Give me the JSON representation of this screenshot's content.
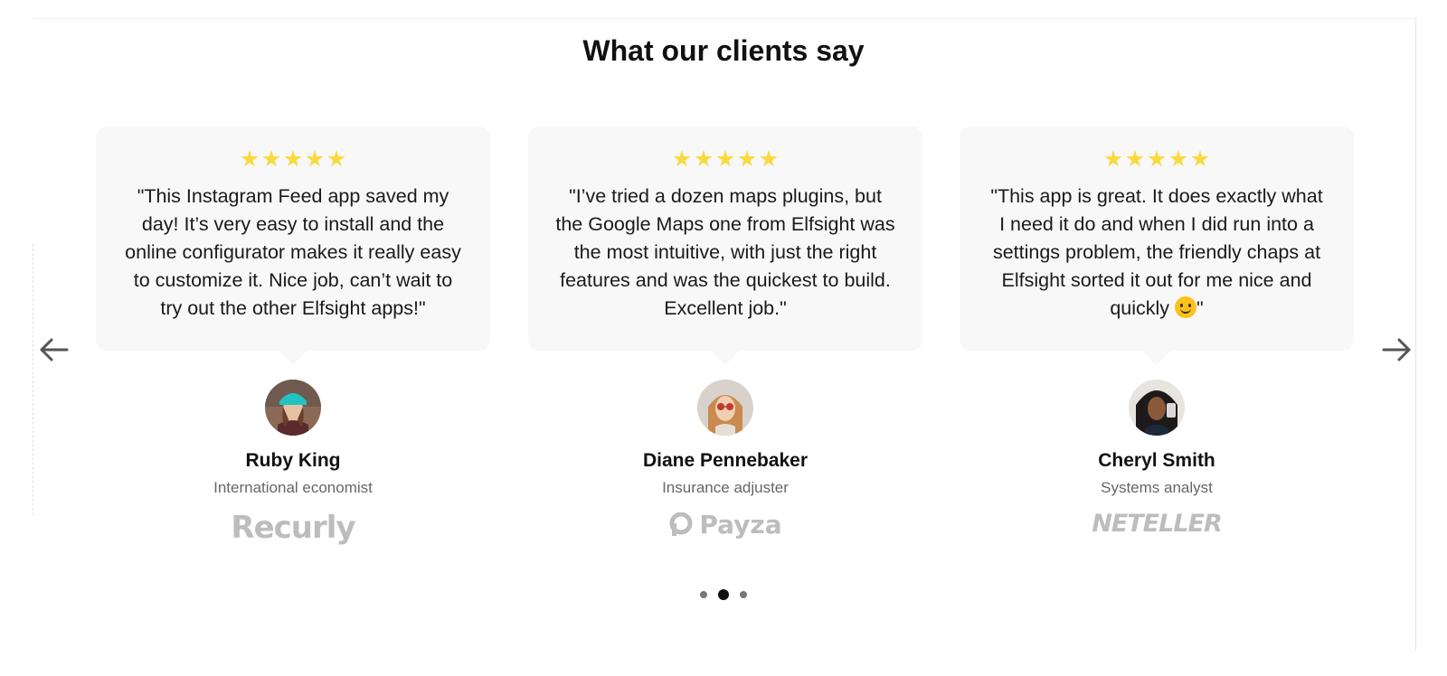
{
  "section": {
    "title": "What our clients say"
  },
  "navigation": {
    "prev_icon": "arrow-left-icon",
    "next_icon": "arrow-right-icon"
  },
  "colors": {
    "star": "#fbd93e",
    "bubble_bg": "#f8f8f8",
    "logo_gray": "#bdbdbd",
    "dot_active": "#111111",
    "dot_inactive": "#777777"
  },
  "testimonials": [
    {
      "rating": 5,
      "quote": "\"This Instagram Feed app saved my day! It’s very easy to install and the online configurator makes it really easy to customize it. Nice job, can’t wait to try out the other Elfsight apps!\"",
      "name": "Ruby King",
      "role": "International economist",
      "company_logo": "Recurly"
    },
    {
      "rating": 5,
      "quote": "\"I’ve tried a dozen maps plugins, but the Google Maps one from Elfsight was the most intuitive, with just the right features and was the quickest to build. Excellent job.\"",
      "name": "Diane Pennebaker",
      "role": "Insurance adjuster",
      "company_logo": "Payza"
    },
    {
      "rating": 5,
      "quote_before_emoji": "\"This app is great. It does exactly what I need it do and when I did run into a settings problem, the friendly chaps at Elfsight sorted it out for me nice and quickly ",
      "quote_emoji": "smiling-face-emoji",
      "quote_after_emoji": "\"",
      "name": "Cheryl Smith",
      "role": "Systems analyst",
      "company_logo": "NETELLER"
    }
  ],
  "pagination": {
    "total": 3,
    "active_index": 1
  }
}
